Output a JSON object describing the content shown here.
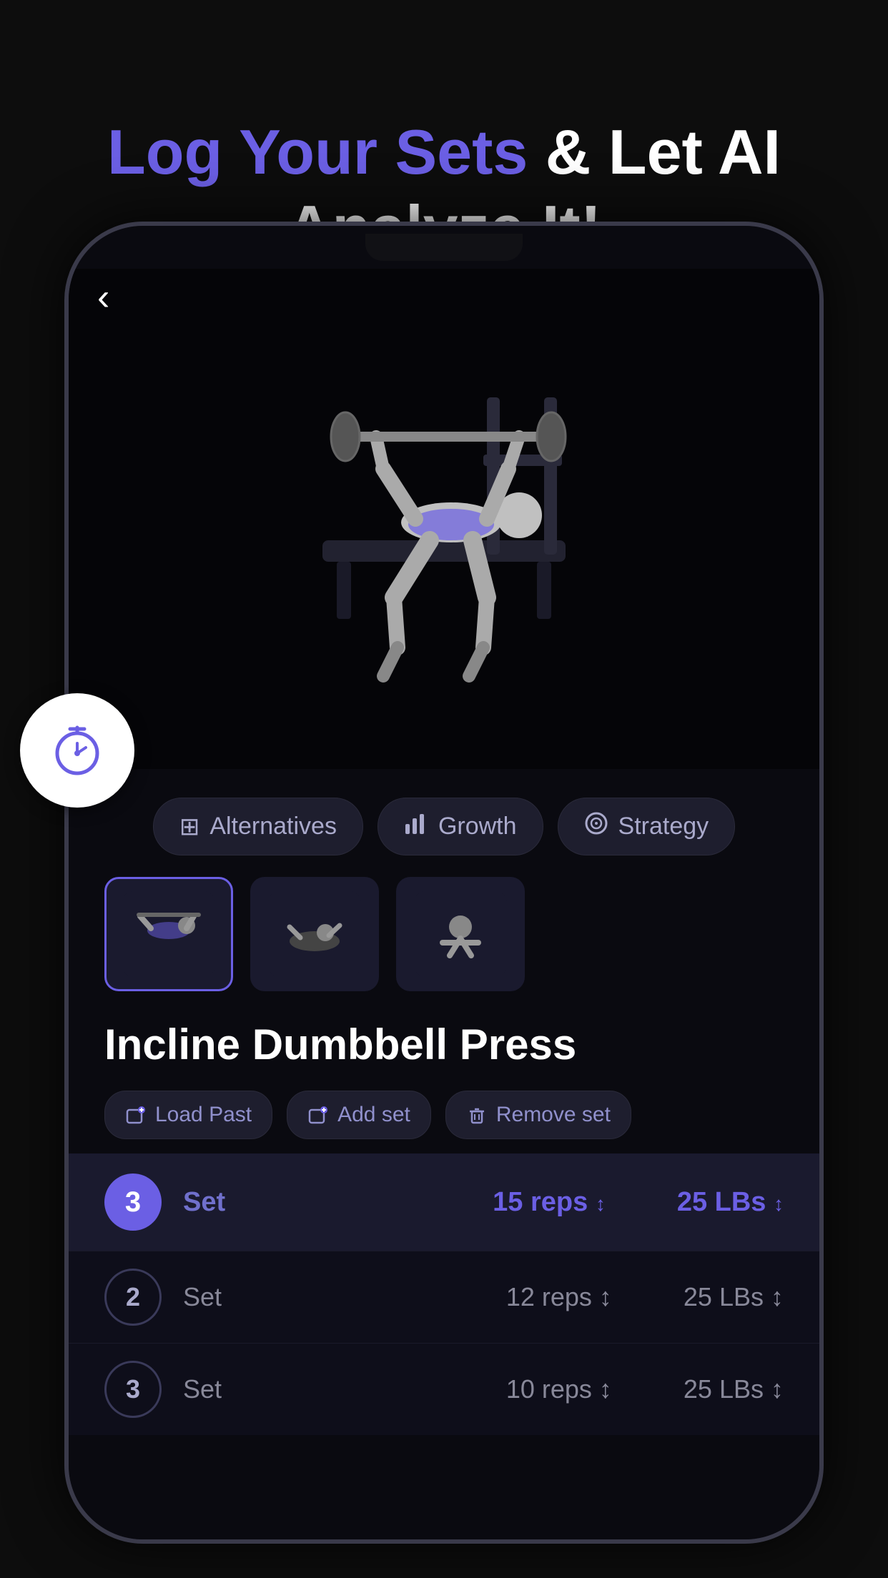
{
  "header": {
    "line1_highlight": "Log Your Sets",
    "line1_normal": " & Let AI",
    "line2": "Analyze It!"
  },
  "exercise": {
    "name": "Incline Dumbbell Press",
    "action_buttons": [
      {
        "id": "alternatives",
        "icon": "⊞",
        "label": "Alternatives"
      },
      {
        "id": "growth",
        "icon": "📊",
        "label": "Growth"
      },
      {
        "id": "strategy",
        "icon": "🎯",
        "label": "Strategy"
      }
    ],
    "thumbnails": [
      {
        "id": 1,
        "active": true
      },
      {
        "id": 2,
        "active": false
      },
      {
        "id": 3,
        "active": false
      }
    ],
    "set_actions": [
      {
        "id": "load-past",
        "icon": "🏋",
        "label": "Load Past"
      },
      {
        "id": "add-set",
        "icon": "🏋",
        "label": "Add set"
      },
      {
        "id": "remove-set",
        "icon": "🗑",
        "label": "Remove set"
      }
    ]
  },
  "active_set": {
    "number": "3",
    "label": "Set",
    "reps": "15 reps",
    "weight": "25 LBs",
    "sort_indicator": "↕"
  },
  "sets": [
    {
      "number": "2",
      "label": "Set",
      "reps": "12 reps",
      "weight": "25 LBs"
    },
    {
      "number": "3",
      "label": "Set",
      "reps": "10 reps",
      "weight": "25 LBs"
    }
  ],
  "back_button": "‹",
  "timer_icon_color": "#6B5FE4"
}
